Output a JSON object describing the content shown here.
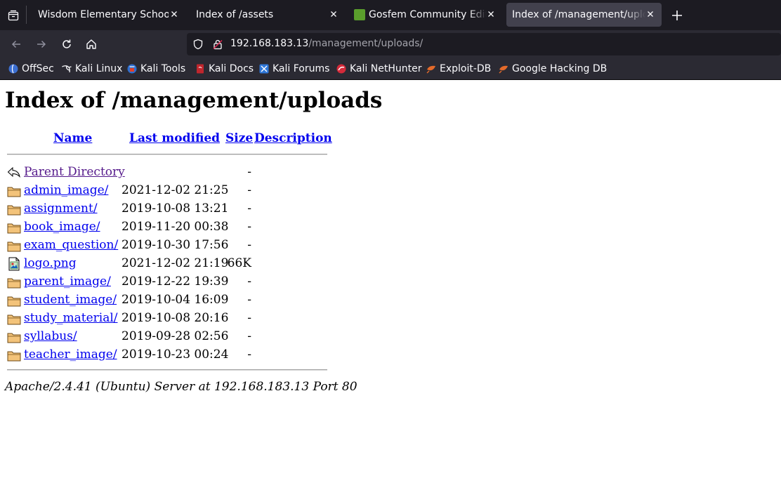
{
  "browser": {
    "tabs": [
      {
        "label": "Wisdom Elementary School",
        "active": false
      },
      {
        "label": "Index of /assets",
        "active": false
      },
      {
        "label": "Gosfem Community Editio",
        "active": false,
        "favicon": "gosfem-favicon"
      },
      {
        "label": "Index of /management/uploa",
        "active": true
      }
    ],
    "url": {
      "host": "192.168.183.13",
      "path": "/management/uploads/"
    },
    "bookmarks": [
      {
        "label": "OffSec",
        "icon": "offsec-icon"
      },
      {
        "label": "Kali Linux",
        "icon": "kali-dragon-icon"
      },
      {
        "label": "Kali Tools",
        "icon": "kali-tools-icon"
      },
      {
        "label": "Kali Docs",
        "icon": "kali-docs-icon"
      },
      {
        "label": "Kali Forums",
        "icon": "kali-forums-icon"
      },
      {
        "label": "Kali NetHunter",
        "icon": "kali-nethunter-icon"
      },
      {
        "label": "Exploit-DB",
        "icon": "exploit-db-icon"
      },
      {
        "label": "Google Hacking DB",
        "icon": "ghdb-icon"
      }
    ]
  },
  "listing": {
    "title": "Index of /management/uploads",
    "columns": {
      "name": "Name",
      "modified": "Last modified",
      "size": "Size",
      "description": "Description"
    },
    "rows": [
      {
        "name": "Parent Directory",
        "modified": "",
        "size": "-",
        "icon": "back-arrow-icon"
      },
      {
        "name": "admin_image/",
        "modified": "2021-12-02 21:25",
        "size": "-",
        "icon": "folder-icon"
      },
      {
        "name": "assignment/",
        "modified": "2019-10-08 13:21",
        "size": "-",
        "icon": "folder-icon"
      },
      {
        "name": "book_image/",
        "modified": "2019-11-20 00:38",
        "size": "-",
        "icon": "folder-icon"
      },
      {
        "name": "exam_question/",
        "modified": "2019-10-30 17:56",
        "size": "-",
        "icon": "folder-icon"
      },
      {
        "name": "logo.png",
        "modified": "2021-12-02 21:19",
        "size": "66K",
        "icon": "image-file-icon"
      },
      {
        "name": "parent_image/",
        "modified": "2019-12-22 19:39",
        "size": "-",
        "icon": "folder-icon"
      },
      {
        "name": "student_image/",
        "modified": "2019-10-04 16:09",
        "size": "-",
        "icon": "folder-icon"
      },
      {
        "name": "study_material/",
        "modified": "2019-10-08 20:16",
        "size": "-",
        "icon": "folder-icon"
      },
      {
        "name": "syllabus/",
        "modified": "2019-09-28 02:56",
        "size": "-",
        "icon": "folder-icon"
      },
      {
        "name": "teacher_image/",
        "modified": "2019-10-23 00:24",
        "size": "-",
        "icon": "folder-icon"
      }
    ],
    "server_signature": "Apache/2.4.41 (Ubuntu) Server at 192.168.183.13 Port 80"
  }
}
